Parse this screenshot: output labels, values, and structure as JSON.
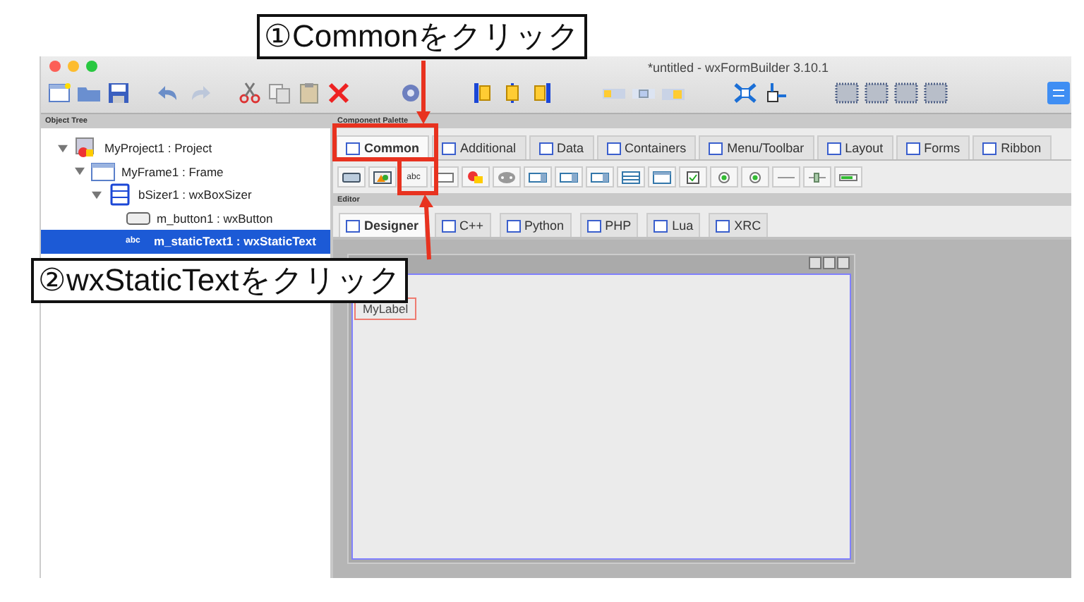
{
  "annotations": [
    {
      "text": "①Commonをクリック"
    },
    {
      "text": "②wxStaticTextをクリック"
    }
  ],
  "window": {
    "title": "*untitled - wxFormBuilder 3.10.1"
  },
  "object_tree": {
    "header": "Object Tree",
    "items": [
      {
        "label": "MyProject1 : Project",
        "kind": "project",
        "expanded": true,
        "selected": false,
        "children": [
          {
            "label": "MyFrame1 : Frame",
            "kind": "frame",
            "expanded": true,
            "selected": false,
            "children": [
              {
                "label": "bSizer1 : wxBoxSizer",
                "kind": "sizer",
                "expanded": true,
                "selected": false,
                "children": [
                  {
                    "label": "m_button1 : wxButton",
                    "kind": "button",
                    "selected": false
                  },
                  {
                    "label": "m_staticText1 : wxStaticText",
                    "kind": "text",
                    "icon_text": "abc",
                    "selected": true
                  }
                ]
              }
            ]
          }
        ]
      }
    ]
  },
  "component_palette": {
    "header": "Component Palette",
    "tabs": [
      {
        "label": "Common",
        "selected": true
      },
      {
        "label": "Additional",
        "selected": false
      },
      {
        "label": "Data",
        "selected": false
      },
      {
        "label": "Containers",
        "selected": false
      },
      {
        "label": "Menu/Toolbar",
        "selected": false
      },
      {
        "label": "Layout",
        "selected": false
      },
      {
        "label": "Forms",
        "selected": false
      },
      {
        "label": "Ribbon",
        "selected": false
      }
    ],
    "components": [
      {
        "kind": "button"
      },
      {
        "kind": "bitmap-button"
      },
      {
        "kind": "text",
        "label": "abc"
      },
      {
        "kind": "text-field"
      },
      {
        "kind": "combo"
      },
      {
        "kind": "choice"
      },
      {
        "kind": "list"
      },
      {
        "kind": "list"
      },
      {
        "kind": "list"
      },
      {
        "kind": "listbox"
      },
      {
        "kind": "listctrl"
      },
      {
        "kind": "checkbox"
      },
      {
        "kind": "radio"
      },
      {
        "kind": "radio"
      },
      {
        "kind": "line"
      },
      {
        "kind": "slider"
      },
      {
        "kind": "gauge"
      }
    ]
  },
  "editor": {
    "header": "Editor",
    "tabs": [
      {
        "label": "Designer",
        "selected": true
      },
      {
        "label": "C++",
        "selected": false
      },
      {
        "label": "Python",
        "selected": false
      },
      {
        "label": "PHP",
        "selected": false
      },
      {
        "label": "Lua",
        "selected": false
      },
      {
        "label": "XRC",
        "selected": false
      }
    ],
    "frame": {
      "label": {
        "text": "MyLabel",
        "selected": true
      }
    }
  }
}
